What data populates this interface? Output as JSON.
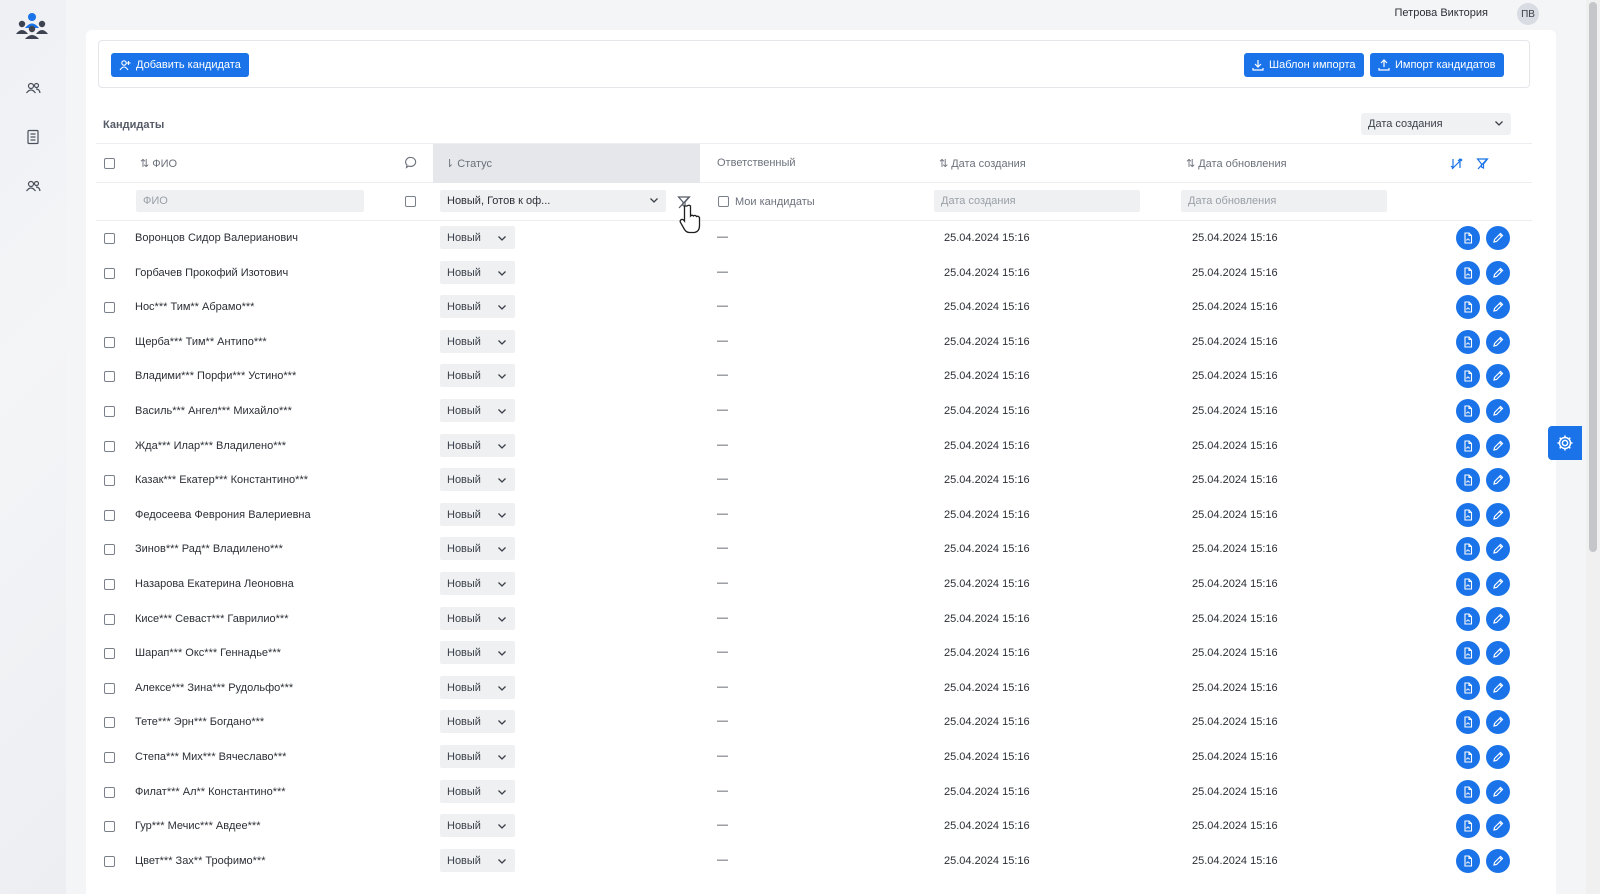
{
  "user": {
    "name": "Петрова Виктория",
    "initials": "ПВ"
  },
  "toolbar": {
    "add_candidate": "Добавить кандидата",
    "import_template": "Шаблон импорта",
    "import_candidates": "Импорт кандидатов"
  },
  "list": {
    "title": "Кандидаты",
    "sort_value": "Дата создания"
  },
  "columns": {
    "fio": "ФИО",
    "status": "Статус",
    "responsible": "Ответственный",
    "created": "Дата создания",
    "updated": "Дата обновления"
  },
  "filters": {
    "fio_placeholder": "ФИО",
    "status_value": "Новый, Готов к оф...",
    "my_candidates": "Мои кандидаты",
    "created_placeholder": "Дата создания",
    "updated_placeholder": "Дата обновления"
  },
  "rows": [
    {
      "name": "Воронцов Сидор Валерианович",
      "status": "Новый",
      "responsible": "—",
      "created": "25.04.2024 15:16",
      "updated": "25.04.2024 15:16"
    },
    {
      "name": "Горбачев Прокофий Изотович",
      "status": "Новый",
      "responsible": "—",
      "created": "25.04.2024 15:16",
      "updated": "25.04.2024 15:16"
    },
    {
      "name": "Нос*** Тим** Абрамо***",
      "status": "Новый",
      "responsible": "—",
      "created": "25.04.2024 15:16",
      "updated": "25.04.2024 15:16"
    },
    {
      "name": "Щерба*** Тим** Антипо***",
      "status": "Новый",
      "responsible": "—",
      "created": "25.04.2024 15:16",
      "updated": "25.04.2024 15:16"
    },
    {
      "name": "Владими*** Порфи*** Устино***",
      "status": "Новый",
      "responsible": "—",
      "created": "25.04.2024 15:16",
      "updated": "25.04.2024 15:16"
    },
    {
      "name": "Василь*** Ангел*** Михайло***",
      "status": "Новый",
      "responsible": "—",
      "created": "25.04.2024 15:16",
      "updated": "25.04.2024 15:16"
    },
    {
      "name": "Жда*** Илар*** Владилено***",
      "status": "Новый",
      "responsible": "—",
      "created": "25.04.2024 15:16",
      "updated": "25.04.2024 15:16"
    },
    {
      "name": "Казак*** Екатер*** Константино***",
      "status": "Новый",
      "responsible": "—",
      "created": "25.04.2024 15:16",
      "updated": "25.04.2024 15:16"
    },
    {
      "name": "Федосеева Феврония Валериевна",
      "status": "Новый",
      "responsible": "—",
      "created": "25.04.2024 15:16",
      "updated": "25.04.2024 15:16"
    },
    {
      "name": "Зинов*** Рад** Владилено***",
      "status": "Новый",
      "responsible": "—",
      "created": "25.04.2024 15:16",
      "updated": "25.04.2024 15:16"
    },
    {
      "name": "Назарова Екатерина Леоновна",
      "status": "Новый",
      "responsible": "—",
      "created": "25.04.2024 15:16",
      "updated": "25.04.2024 15:16"
    },
    {
      "name": "Кисе*** Севаст*** Гаврилио***",
      "status": "Новый",
      "responsible": "—",
      "created": "25.04.2024 15:16",
      "updated": "25.04.2024 15:16"
    },
    {
      "name": "Шарап*** Окс*** Геннадье***",
      "status": "Новый",
      "responsible": "—",
      "created": "25.04.2024 15:16",
      "updated": "25.04.2024 15:16"
    },
    {
      "name": "Алексе*** Зина*** Рудольфо***",
      "status": "Новый",
      "responsible": "—",
      "created": "25.04.2024 15:16",
      "updated": "25.04.2024 15:16"
    },
    {
      "name": "Тете*** Эрн*** Богдано***",
      "status": "Новый",
      "responsible": "—",
      "created": "25.04.2024 15:16",
      "updated": "25.04.2024 15:16"
    },
    {
      "name": "Степа*** Мих*** Вячеславо***",
      "status": "Новый",
      "responsible": "—",
      "created": "25.04.2024 15:16",
      "updated": "25.04.2024 15:16"
    },
    {
      "name": "Филат*** Ал** Константино***",
      "status": "Новый",
      "responsible": "—",
      "created": "25.04.2024 15:16",
      "updated": "25.04.2024 15:16"
    },
    {
      "name": "Гур*** Мечис*** Авдее***",
      "status": "Новый",
      "responsible": "—",
      "created": "25.04.2024 15:16",
      "updated": "25.04.2024 15:16"
    },
    {
      "name": "Цвет*** Зах** Трофимо***",
      "status": "Новый",
      "responsible": "—",
      "created": "25.04.2024 15:16",
      "updated": "25.04.2024 15:16"
    }
  ],
  "icons": {
    "logo": "people-group-logo",
    "nav": [
      "users-icon",
      "document-list-icon",
      "users-icon"
    ],
    "row_actions": [
      "pdf-file-icon",
      "edit-pencil-icon"
    ],
    "header_actions": [
      "clear-sort-icon",
      "clear-filter-icon"
    ],
    "settings": "gear-icon"
  },
  "colors": {
    "accent": "#1a73e8",
    "page_bg": "#f4f5f7"
  }
}
